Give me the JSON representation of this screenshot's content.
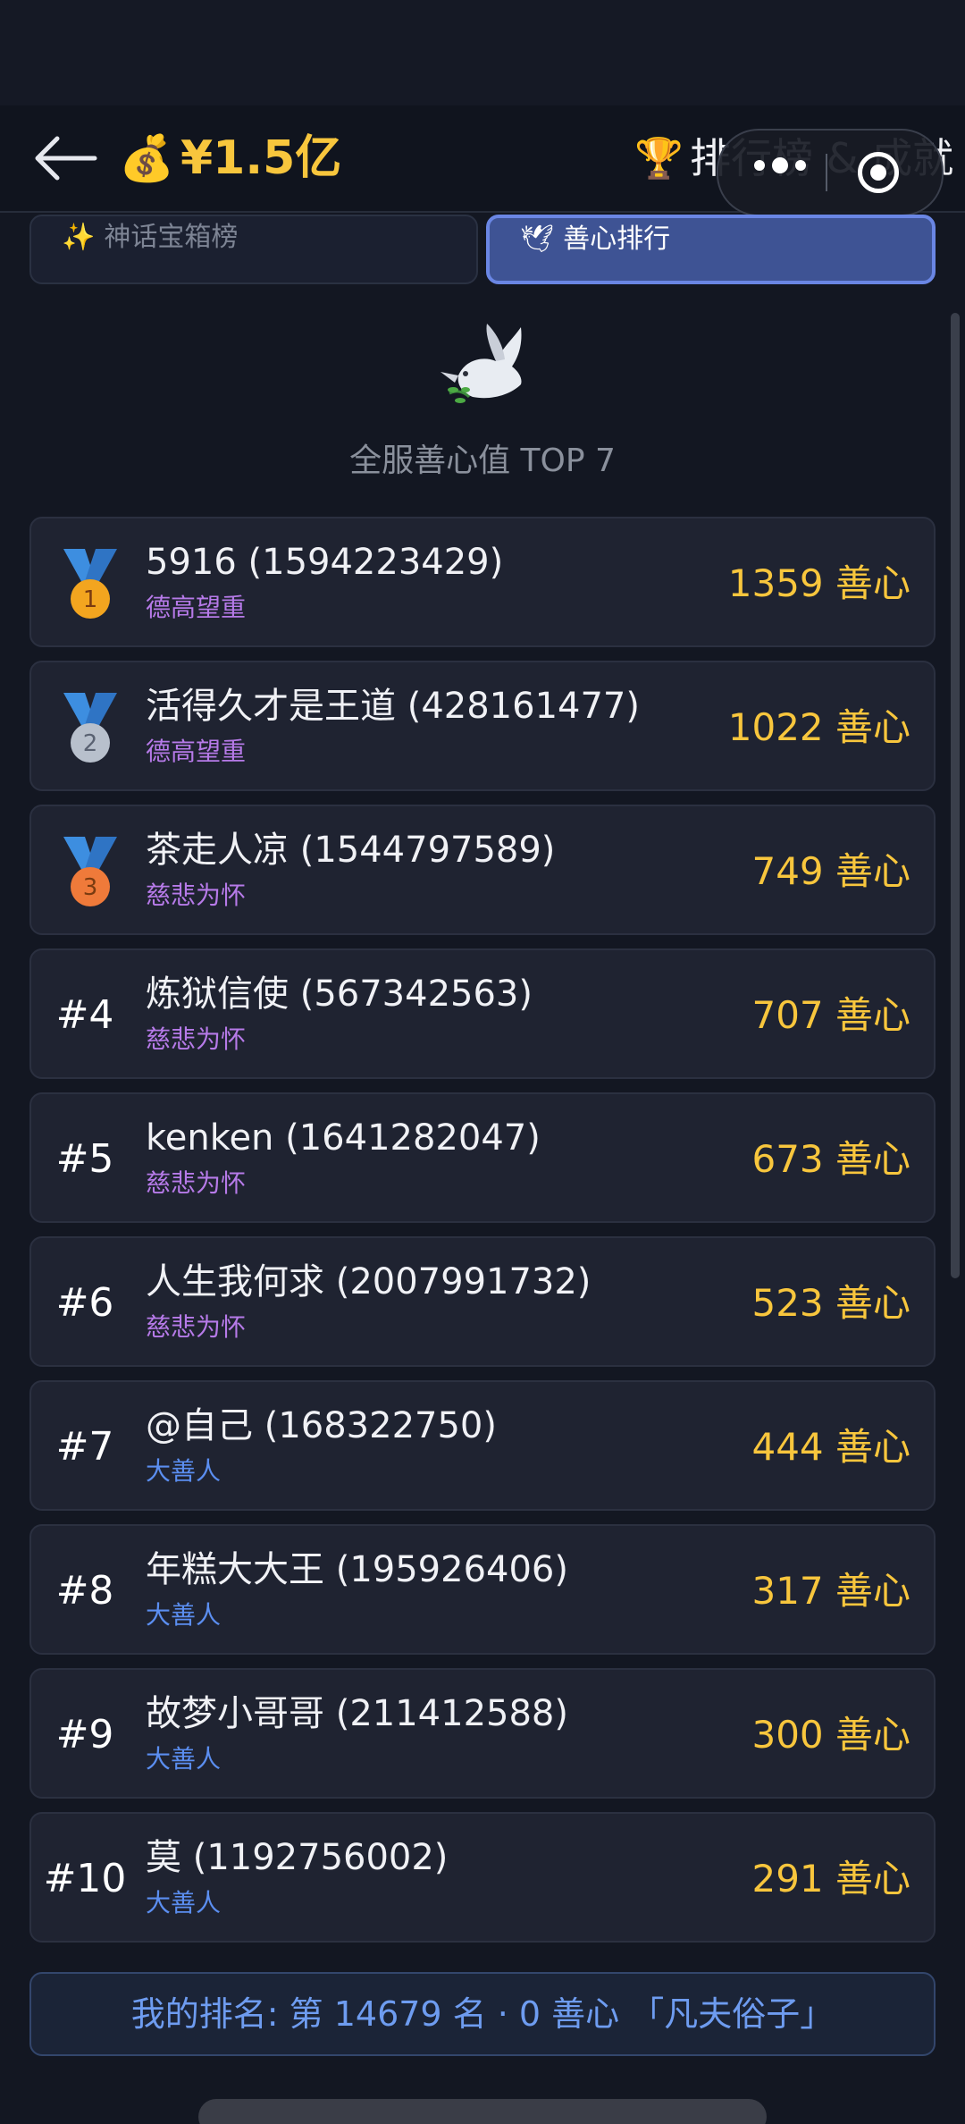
{
  "header": {
    "money_icon": "💰",
    "money": "¥1.5亿",
    "trophy_icon": "🏆",
    "title": "排行榜 & 成就"
  },
  "tabs": [
    {
      "icon": "✨",
      "label": "神话宝箱榜",
      "active": false
    },
    {
      "icon": "🕊",
      "label": "善心排行",
      "active": true
    }
  ],
  "section": {
    "title": "全服善心值 TOP 7"
  },
  "rankings": [
    {
      "rank": "1",
      "name": "5916 (1594223429)",
      "title": "德高望重",
      "title_color": "#b67ae8",
      "score": "1359 善心"
    },
    {
      "rank": "2",
      "name": "活得久才是王道 (428161477)",
      "title": "德高望重",
      "title_color": "#b67ae8",
      "score": "1022 善心"
    },
    {
      "rank": "3",
      "name": "茶走人凉 (1544797589)",
      "title": "慈悲为怀",
      "title_color": "#b67ae8",
      "score": "749 善心"
    },
    {
      "rank": "#4",
      "name": "炼狱信使 (567342563)",
      "title": "慈悲为怀",
      "title_color": "#b67ae8",
      "score": "707 善心"
    },
    {
      "rank": "#5",
      "name": "kenken (1641282047)",
      "title": "慈悲为怀",
      "title_color": "#b67ae8",
      "score": "673 善心"
    },
    {
      "rank": "#6",
      "name": "人生我何求 (2007991732)",
      "title": "慈悲为怀",
      "title_color": "#b67ae8",
      "score": "523 善心"
    },
    {
      "rank": "#7",
      "name": "@自己 (168322750)",
      "title": "大善人",
      "title_color": "#5b8ef0",
      "score": "444 善心"
    },
    {
      "rank": "#8",
      "name": "年糕大大王 (195926406)",
      "title": "大善人",
      "title_color": "#5b8ef0",
      "score": "317 善心"
    },
    {
      "rank": "#9",
      "name": "故梦小哥哥 (211412588)",
      "title": "大善人",
      "title_color": "#5b8ef0",
      "score": "300 善心"
    },
    {
      "rank": "#10",
      "name": "莫 (1192756002)",
      "title": "大善人",
      "title_color": "#5b8ef0",
      "score": "291 善心"
    }
  ],
  "my_rank": {
    "text": "我的排名: 第 14679 名 · 0 善心 「凡夫俗子」"
  },
  "colors": {
    "gold": "#f8c63d",
    "accent_blue": "#6a86e4",
    "medal_gold": "#f3a51f",
    "medal_silver": "#b8c0cc",
    "medal_bronze": "#ef7a3a",
    "ribbon": "#3d8ee0"
  }
}
